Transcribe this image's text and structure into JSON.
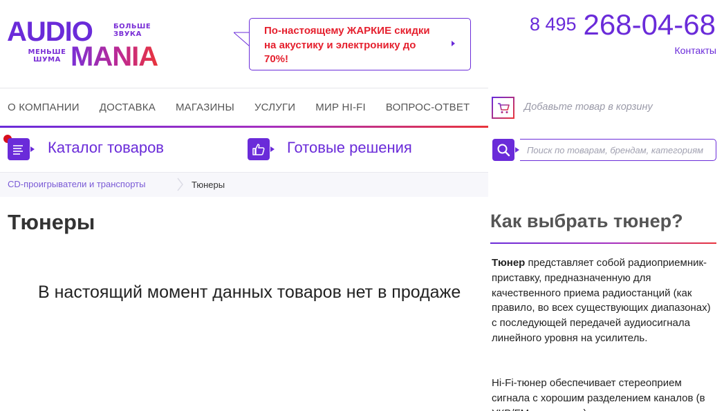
{
  "logo": {
    "word1": "AUDIO",
    "word2": "MANIA",
    "tagline_top": "БОЛЬШЕ ЗВУКА",
    "tagline_bottom": "МЕНЬШЕ ШУМА"
  },
  "promo": {
    "text": "По-настоящему ЖАРКИЕ скидки на акустику и электронику до 70%!"
  },
  "header": {
    "phone_code": "8 495",
    "phone_number": "268-04-68",
    "contacts_link": "Контакты"
  },
  "nav": {
    "items": [
      "О КОМПАНИИ",
      "ДОСТАВКА",
      "МАГАЗИНЫ",
      "УСЛУГИ",
      "МИР HI-FI",
      "ВОПРОС-ОТВЕТ"
    ]
  },
  "cart": {
    "label": "Добавьте товар в корзину"
  },
  "catalog": {
    "catalog_label": "Каталог товаров",
    "ready_label": "Готовые решения"
  },
  "search": {
    "placeholder": "Поиск по товарам, брендам, категориям"
  },
  "breadcrumb": {
    "parent": "CD-проигрыватели и транспорты",
    "current": "Тюнеры"
  },
  "main": {
    "title": "Тюнеры",
    "empty_message": "В настоящий момент данных товаров нет в продаже"
  },
  "sidebar": {
    "title": "Как выбрать тюнер?",
    "p1_bold": "Тюнер",
    "p1_rest": " представляет собой радиоприемник-приставку, предназначенную для качественного приема радиостанций (как правило, во всех существующих диапазонах) с последующей передачей аудиосигнала линейного уровня на усилитель.",
    "p2": "Hi-Fi-тюнер обеспечивает стереоприем сигнала с хорошим разделением каналов (в УКВ/FM-диапазоне)"
  },
  "colors": {
    "brand_purple": "#6a2bd9",
    "brand_red": "#e9343b",
    "promo_red": "#e5202e"
  }
}
